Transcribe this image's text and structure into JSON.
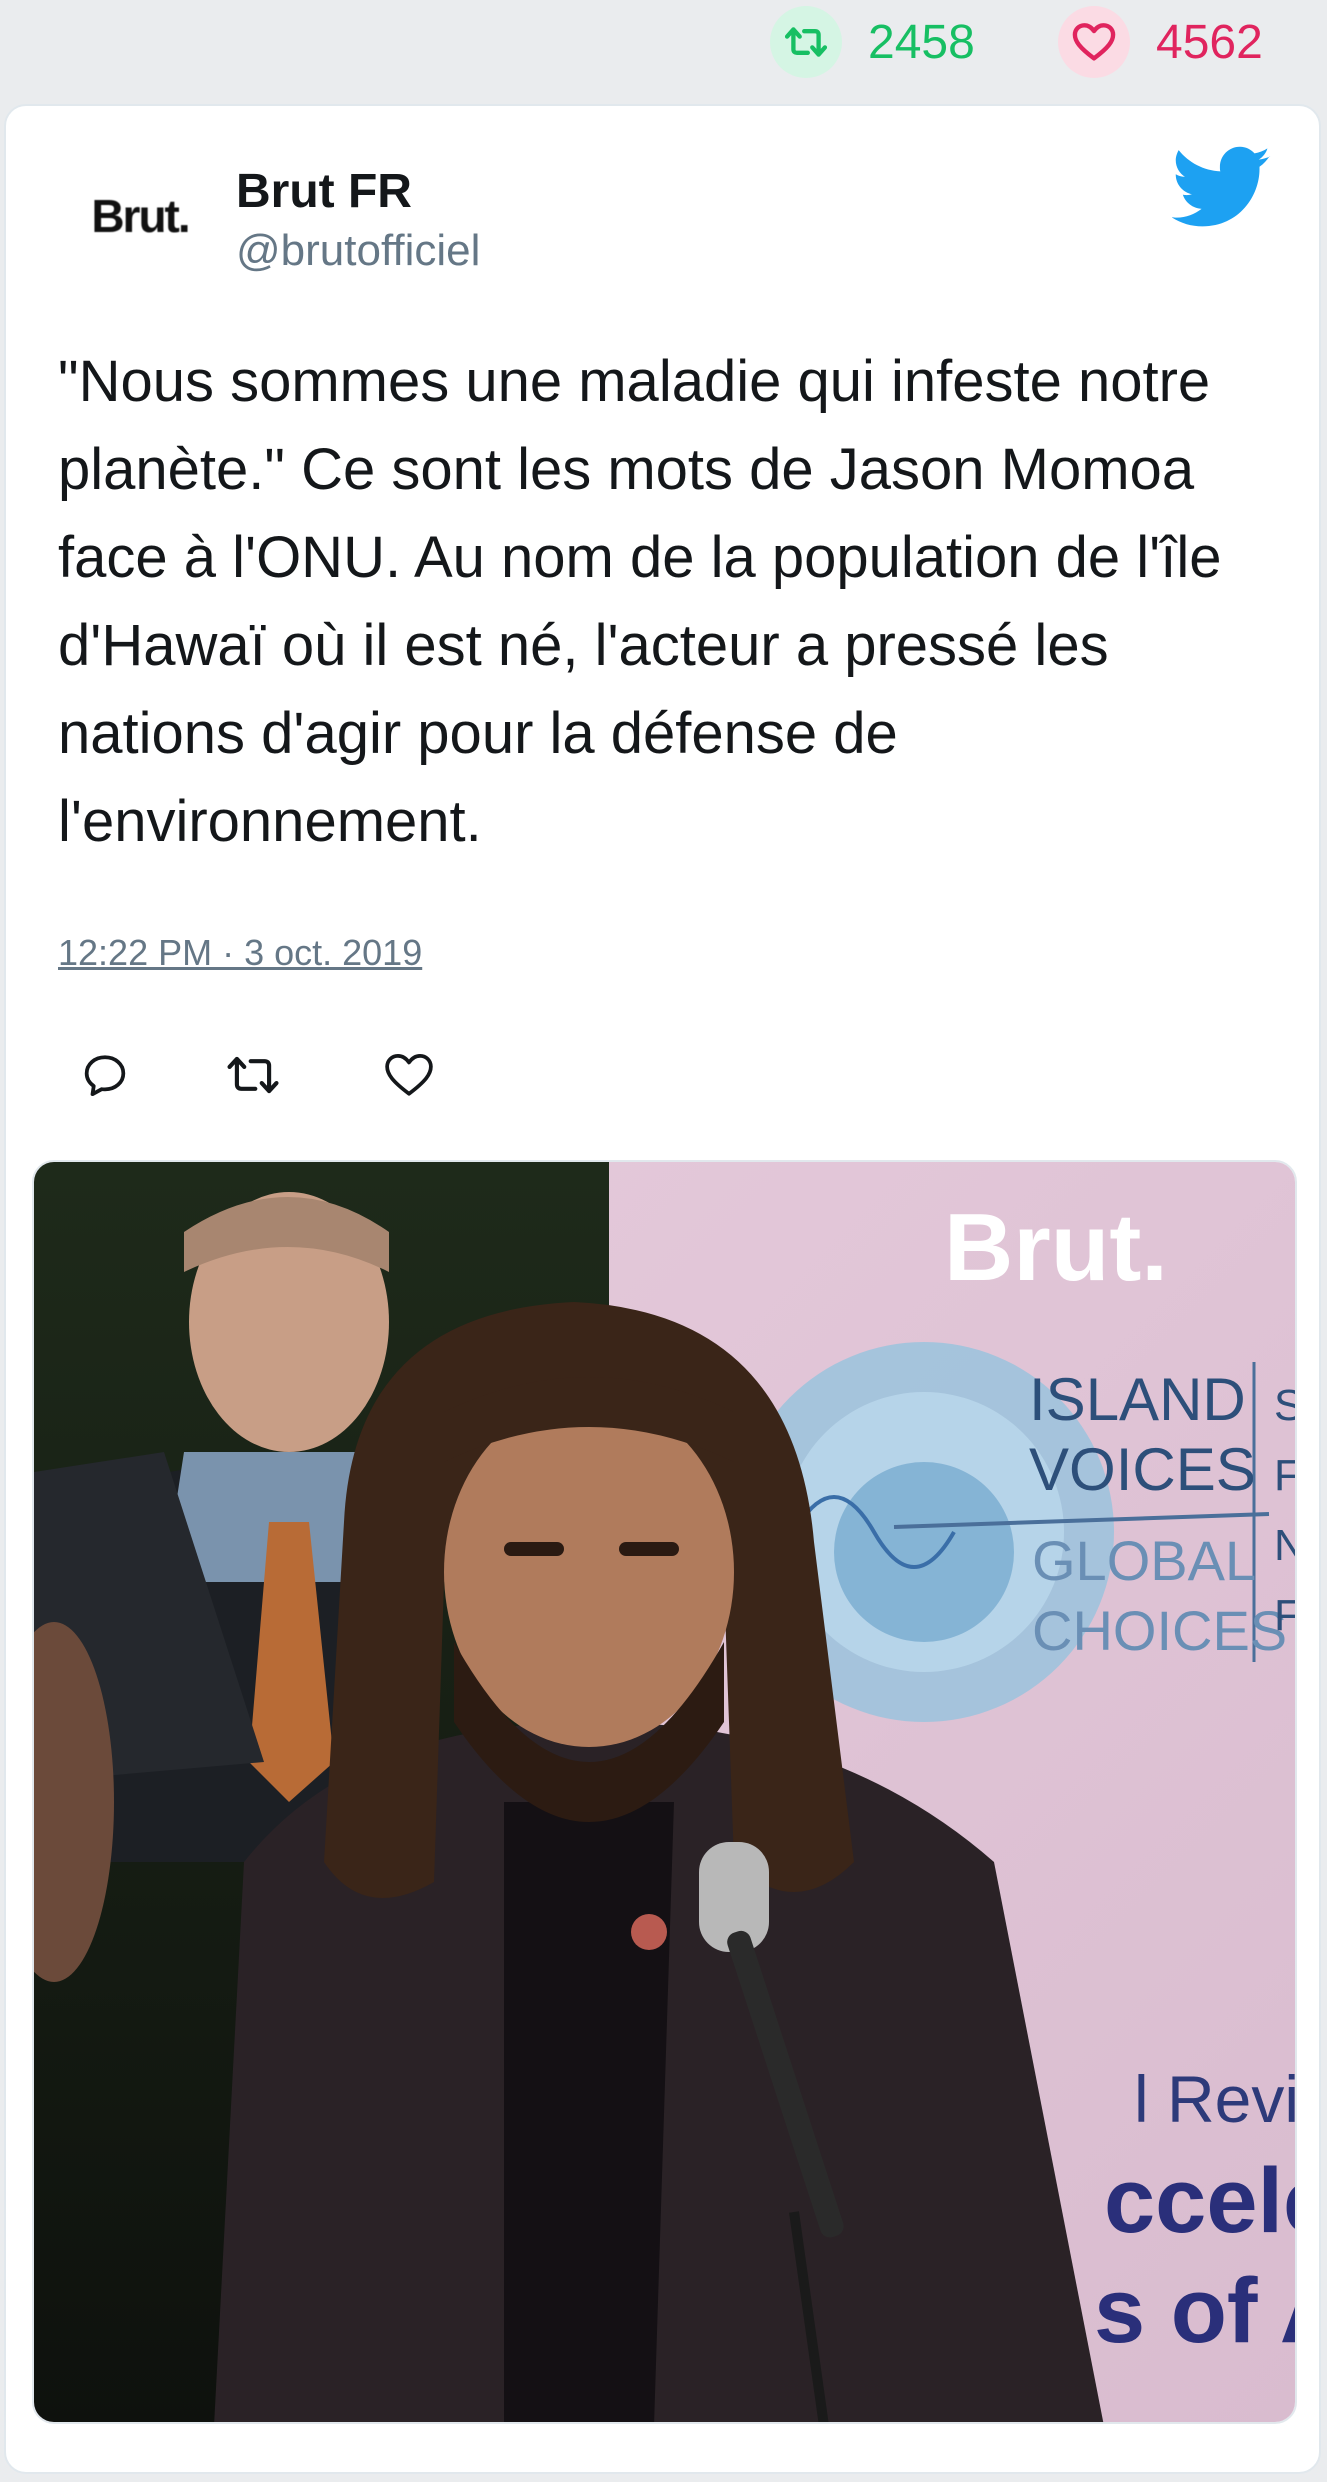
{
  "stats": {
    "retweets": "2458",
    "likes": "4562",
    "retweet_icon": "retweet-icon",
    "like_icon": "heart-icon",
    "retweet_color": "#17bf63",
    "like_color": "#e0245e"
  },
  "tweet": {
    "avatar_text": "Brut.",
    "user_name": "Brut FR",
    "user_handle": "@brutofficiel",
    "text": "\"Nous sommes une maladie qui infeste notre planète.\" Ce sont les mots de Jason Momoa face à l'ONU. Au nom de la population de l'île d'Hawaï où il est né, l'acteur a pressé les nations d'agir pour la défense de l'environnement.",
    "timestamp": "12:22 PM · 3 oct. 2019",
    "brand_icon": "twitter-bird-icon",
    "brand_color": "#1da1f2"
  },
  "actions": [
    {
      "name": "reply",
      "icon": "reply-icon"
    },
    {
      "name": "retweet",
      "icon": "retweet-icon"
    },
    {
      "name": "like",
      "icon": "heart-icon"
    }
  ],
  "media": {
    "brand_text": "Brut.",
    "banner_lines": [
      "ISLAND",
      "VOICES",
      "GLOBAL",
      "CHOICES"
    ],
    "banner_bottom": [
      "l Review",
      "ccele",
      "s of Ac"
    ],
    "right_edge_letters": [
      "S",
      "F",
      "N",
      "F"
    ]
  }
}
